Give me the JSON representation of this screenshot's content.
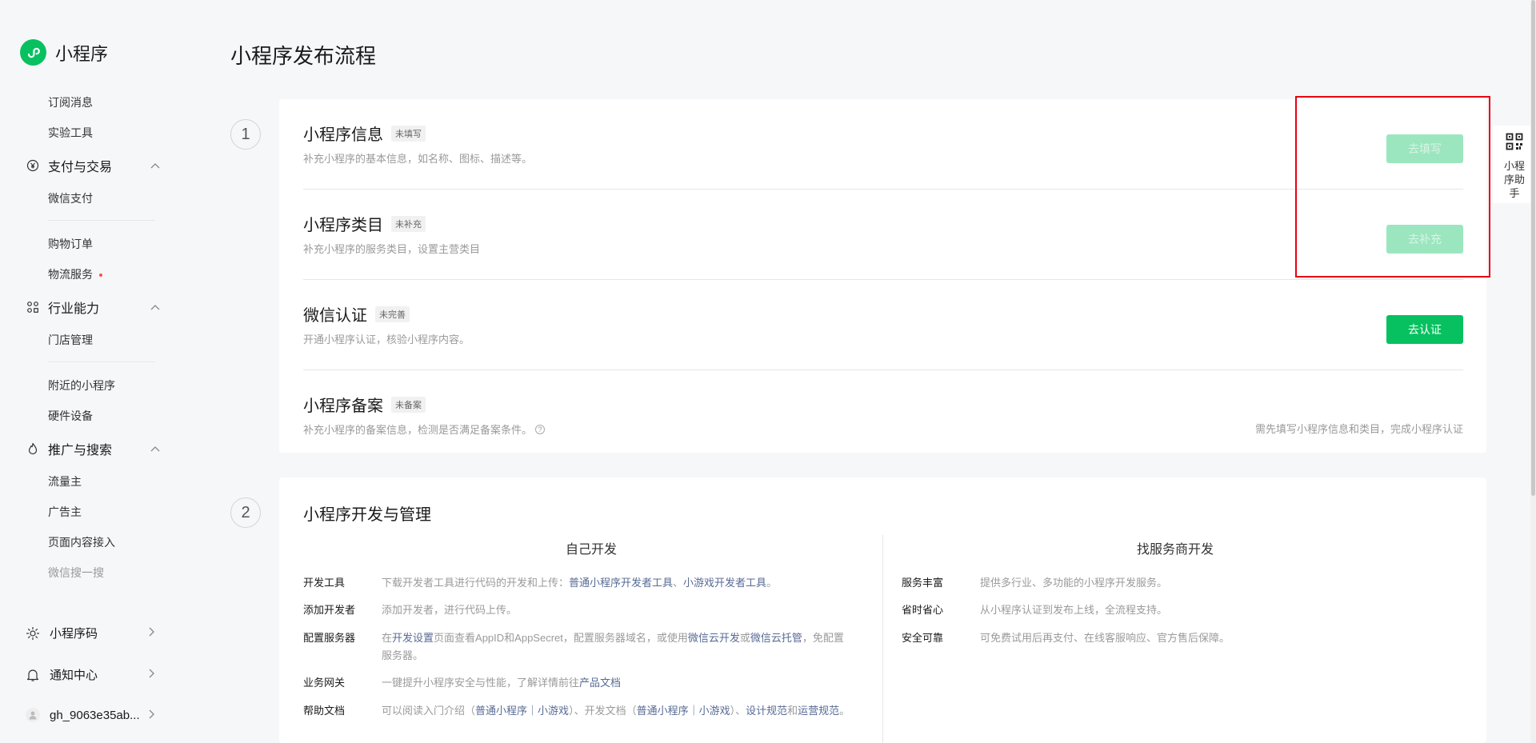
{
  "app": {
    "name": "小程序"
  },
  "sidebar": {
    "pre_items": [
      "订阅消息",
      "实验工具"
    ],
    "group_pay": {
      "label": "支付与交易",
      "items": [
        "微信支付",
        "购物订单",
        "物流服务"
      ]
    },
    "group_industry": {
      "label": "行业能力",
      "items": [
        "门店管理",
        "附近的小程序",
        "硬件设备"
      ]
    },
    "group_promo": {
      "label": "推广与搜索",
      "items": [
        "流量主",
        "广告主",
        "页面内容接入",
        "微信搜一搜"
      ]
    },
    "bottom": {
      "qrcode": "小程序码",
      "notify": "通知中心",
      "account": "gh_9063e35ab..."
    }
  },
  "page": {
    "title": "小程序发布流程"
  },
  "steps": [
    {
      "number": "1",
      "rows": [
        {
          "title": "小程序信息",
          "tag": "未填写",
          "desc": "补充小程序的基本信息，如名称、图标、描述等。",
          "button": "去填写"
        },
        {
          "title": "小程序类目",
          "tag": "未补充",
          "desc": "补充小程序的服务类目，设置主营类目",
          "button": "去补充"
        },
        {
          "title": "微信认证",
          "tag": "未完善",
          "desc": "开通小程序认证，核验小程序内容。",
          "button": "去认证"
        },
        {
          "title": "小程序备案",
          "tag": "未备案",
          "desc": "补充小程序的备案信息，检测是否满足备案条件。",
          "note": "需先填写小程序信息和类目，完成小程序认证"
        }
      ]
    },
    {
      "number": "2",
      "title": "小程序开发与管理",
      "self_dev": {
        "title": "自己开发",
        "items": [
          {
            "k": "开发工具",
            "v1": "下载开发者工具进行代码的开发和上传：",
            "l1": "普通小程序开发者工具",
            "v2": "、",
            "l2": "小游戏开发者工具",
            "v3": "。"
          },
          {
            "k": "添加开发者",
            "v1": "添加开发者，进行代码上传。"
          },
          {
            "k": "配置服务器",
            "v1": "在",
            "l1": "开发设置",
            "v2": "页面查看AppID和AppSecret，配置服务器域名，或使用",
            "l2": "微信云开发",
            "v3": "或",
            "l3": "微信云托管",
            "v4": "，免配置服务器。"
          },
          {
            "k": "业务网关",
            "v1": "一键提升小程序安全与性能，了解详情前往",
            "l1": "产品文档"
          },
          {
            "k": "帮助文档",
            "v1": "可以阅读入门介绍（",
            "l1": "普通小程序",
            "v2": "｜",
            "l2": "小游戏",
            "v3": "）、开发文档（",
            "l3": "普通小程序",
            "v4": "｜",
            "l4": "小游戏",
            "v5": "）、",
            "l5": "设计规范",
            "v6": "和",
            "l6": "运营规范",
            "v7": "。"
          }
        ]
      },
      "vendor_dev": {
        "title": "找服务商开发",
        "items": [
          {
            "k": "服务丰富",
            "v": "提供多行业、多功能的小程序开发服务。"
          },
          {
            "k": "省时省心",
            "v": "从小程序认证到发布上线，全流程支持。"
          },
          {
            "k": "安全可靠",
            "v": "可免费试用后再支付、在线客服响应、官方售后保障。"
          }
        ]
      }
    }
  ],
  "helper": {
    "label": "小程序助手"
  }
}
